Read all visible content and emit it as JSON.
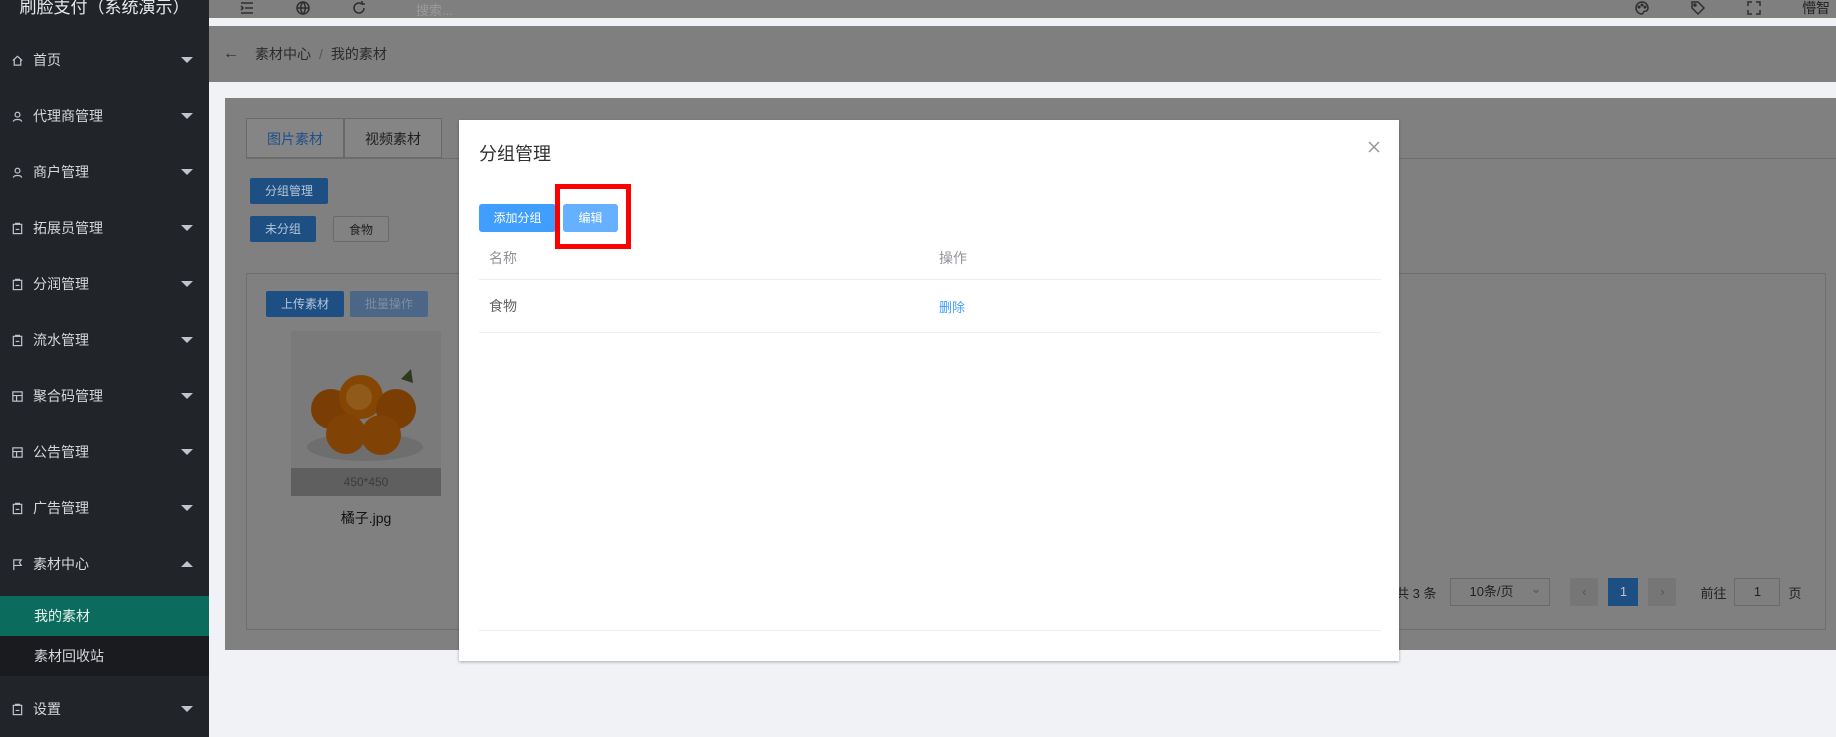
{
  "app": {
    "title": "刷脸支付（系统演示）"
  },
  "sidebar": {
    "items": [
      {
        "label": "首页",
        "icon": "home-icon"
      },
      {
        "label": "代理商管理",
        "icon": "user-icon"
      },
      {
        "label": "商户管理",
        "icon": "user-icon"
      },
      {
        "label": "拓展员管理",
        "icon": "clipboard-icon"
      },
      {
        "label": "分润管理",
        "icon": "clipboard-icon"
      },
      {
        "label": "流水管理",
        "icon": "clipboard-icon"
      },
      {
        "label": "聚合码管理",
        "icon": "grid-icon"
      },
      {
        "label": "公告管理",
        "icon": "grid-icon"
      },
      {
        "label": "广告管理",
        "icon": "clipboard-icon"
      },
      {
        "label": "素材中心",
        "icon": "flag-icon"
      },
      {
        "label": "设置",
        "icon": "clipboard-icon"
      }
    ],
    "subitems": [
      {
        "label": "我的素材"
      },
      {
        "label": "素材回收站"
      }
    ]
  },
  "header": {
    "search_placeholder": "搜索...",
    "user_name": "懵智"
  },
  "breadcrumb": {
    "items": [
      "素材中心",
      "我的素材"
    ],
    "separator": "/"
  },
  "page": {
    "tabs": [
      "图片素材",
      "视频素材"
    ],
    "group_manage_label": "分组管理",
    "group_filters": [
      "未分组",
      "食物"
    ],
    "upload_label": "上传素材",
    "batch_label": "批量操作",
    "thumb": {
      "size": "450*450",
      "name": "橘子.jpg"
    },
    "pager": {
      "total": "共 3 条",
      "page_size": "10条/页",
      "current": "1",
      "goto_label": "前往",
      "goto_value": "1",
      "page_unit": "页"
    }
  },
  "dialog": {
    "title": "分组管理",
    "add_label": "添加分组",
    "edit_label": "编辑",
    "table": {
      "headers": [
        "名称",
        "操作"
      ],
      "rows": [
        {
          "name": "食物",
          "action": "删除"
        }
      ]
    }
  },
  "colors": {
    "primary": "#409eff",
    "primary_light": "#66b1ff",
    "highlight": "#ff0000",
    "sidebar_active": "#0b6b5c"
  }
}
